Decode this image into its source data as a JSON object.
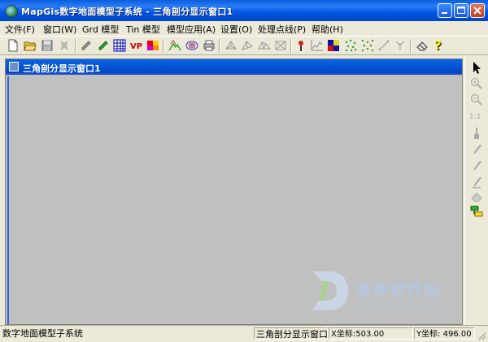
{
  "window": {
    "title": "MapGis数字地面模型子系统 - 三角剖分显示窗口1"
  },
  "menu": [
    {
      "label": "文件(F)"
    },
    {
      "label": "窗口(W)"
    },
    {
      "label": "Grd 模型"
    },
    {
      "label": "Tin 模型"
    },
    {
      "label": "模型应用(A)"
    },
    {
      "label": "设置(O)"
    },
    {
      "label": "处理点线(P)"
    },
    {
      "label": "帮助(H)"
    }
  ],
  "toolbar": {
    "vp_label": "VP",
    "icons": [
      "new-icon",
      "open-icon",
      "save-icon",
      "disabled-tool-icon",
      "pencil-icon",
      "green-pencil-icon",
      "grid-icon",
      "vp-icon",
      "color-palette-icon",
      "contour-icon",
      "rings-icon",
      "print-icon",
      "tin-tool-1-icon",
      "tin-tool-2-icon",
      "tin-tool-3-icon",
      "tin-tool-4-icon",
      "probe-icon",
      "profile-chart-icon",
      "3d-view-icon",
      "scatter-icon",
      "scatter-green-icon",
      "line-tool-icon",
      "branch-icon",
      "eraser-icon",
      "help-icon"
    ]
  },
  "child_window": {
    "title": "三角剖分显示窗口1"
  },
  "watermark": {
    "cn": "多多软件站",
    "url": "ddooo.com"
  },
  "right_tools": {
    "scale_label": "1:1",
    "icons": [
      "pointer-icon",
      "zoom-in-icon",
      "zoom-out-icon",
      "pen-icon",
      "pencil-tool-icon",
      "line-icon",
      "brush-icon",
      "eraser-tool-icon",
      "layers-icon"
    ]
  },
  "status": {
    "system": "数字地面模型子系统",
    "window": "三角剖分显示窗口",
    "x_coord": "X坐标:503.00",
    "y_coord": "Y坐标: 496.00"
  }
}
